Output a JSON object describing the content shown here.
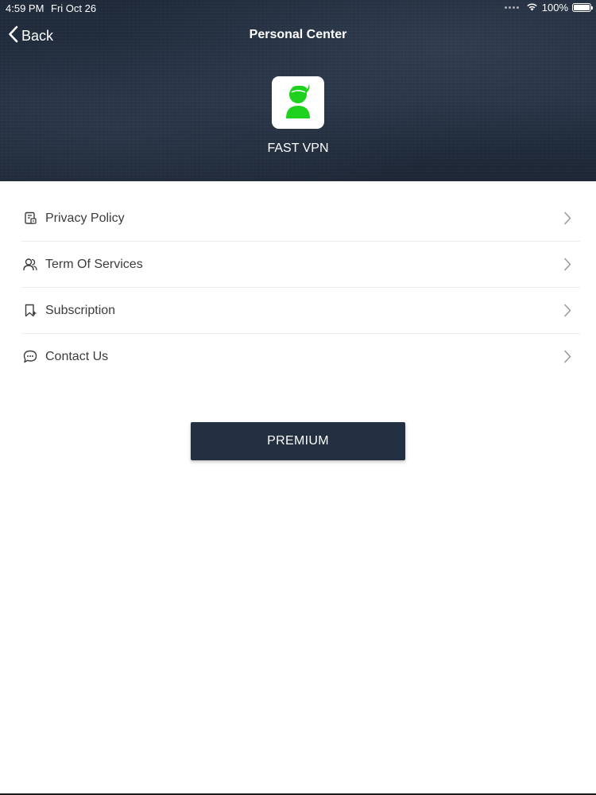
{
  "status_bar": {
    "time": "4:59 PM",
    "date": "Fri Oct 26",
    "battery": "100%",
    "battery_level": 1.0,
    "wifi_icon": "wifi-icon",
    "battery_icon": "battery-icon"
  },
  "nav": {
    "back_label": "Back",
    "back_icon": "chevron-left-icon",
    "title": "Personal Center"
  },
  "profile": {
    "logo_icon": "user-avatar-icon",
    "app_name": "FAST VPN"
  },
  "menu": {
    "items": [
      {
        "label": "Privacy Policy",
        "icon": "document-icon"
      },
      {
        "label": "Term Of Services",
        "icon": "users-icon"
      },
      {
        "label": "Subscription",
        "icon": "bookmark-icon"
      },
      {
        "label": "Contact Us",
        "icon": "chat-bubble-icon"
      }
    ],
    "chevron_icon": "chevron-right-icon"
  },
  "premium_button": {
    "label": "PREMIUM"
  },
  "colors": {
    "header_bg": "#223042",
    "button_bg": "#233041",
    "logo_green": "#1fd11f",
    "text": "#3c3c3c",
    "chevron": "#9a9a9a"
  }
}
